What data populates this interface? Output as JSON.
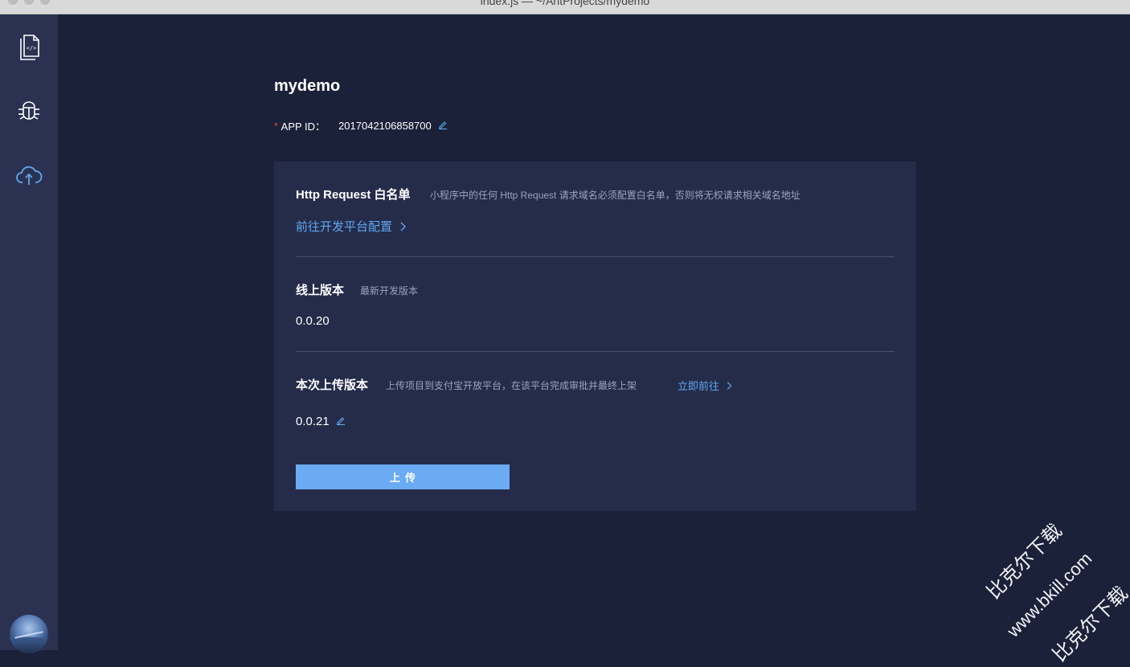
{
  "window": {
    "title": "index.js — ~/AntProjects/mydemo"
  },
  "sidebar": {
    "items": [
      {
        "icon": "code-file-icon",
        "active": false
      },
      {
        "icon": "bug-icon",
        "active": false
      },
      {
        "icon": "cloud-upload-icon",
        "active": true
      }
    ],
    "avatar_icon": "user-avatar"
  },
  "project": {
    "name": "mydemo",
    "app_id_label": "APP ID：",
    "app_id_value": "2017042106858700"
  },
  "whitelist": {
    "title": "Http Request 白名单",
    "desc": "小程序中的任何 Http Request 请求域名必须配置白名单，否则将无权请求相关域名地址",
    "link": "前往开发平台配置"
  },
  "online": {
    "title": "线上版本",
    "desc": "最新开发版本",
    "version": "0.0.20"
  },
  "upload": {
    "title": "本次上传版本",
    "desc": "上传项目到支付宝开放平台，在该平台完成审批并最终上架",
    "link": "立即前往",
    "version": "0.0.21",
    "button": "上传"
  },
  "colors": {
    "background": "#1b2139",
    "sidebar": "#2b3251",
    "panel": "#252c4a",
    "accent": "#5fa8f0",
    "button": "#6aabf4",
    "required": "#f04134"
  },
  "watermark": {
    "line1": "比克尔下载",
    "line2": "www.bkill.com",
    "line3": "比克尔下载"
  }
}
